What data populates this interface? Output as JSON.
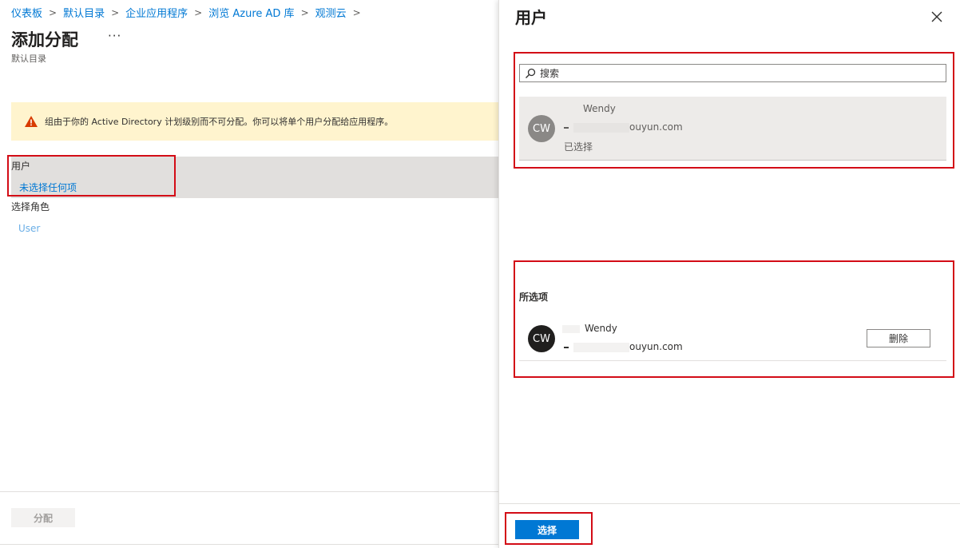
{
  "breadcrumb": {
    "items": [
      "仪表板",
      "默认目录",
      "企业应用程序",
      "浏览 Azure AD 库",
      "观测云"
    ],
    "separator": ">"
  },
  "page": {
    "title": "添加分配",
    "more_label": "···",
    "subtitle": "默认目录"
  },
  "warning": {
    "text": "组由于你的 Active Directory 计划级别而不可分配。你可以将单个用户分配给应用程序。"
  },
  "user_section": {
    "label": "用户",
    "value": "未选择任何项"
  },
  "role_section": {
    "label": "选择角色",
    "value": "User"
  },
  "footer": {
    "assign_label": "分配"
  },
  "panel": {
    "title": "用户",
    "search_placeholder": "搜索",
    "result": {
      "initials": "CW",
      "name": "Wendy",
      "email_suffix": "ouyun.com",
      "status": "已选择"
    },
    "selected_title": "所选项",
    "selected_item": {
      "initials": "CW",
      "name": "Wendy",
      "email_suffix": "ouyun.com",
      "remove_label": "删除"
    },
    "select_label": "选择"
  },
  "colors": {
    "accent": "#0078d4",
    "warning_bg": "#fff4ce",
    "highlight_box": "#d30c16"
  }
}
